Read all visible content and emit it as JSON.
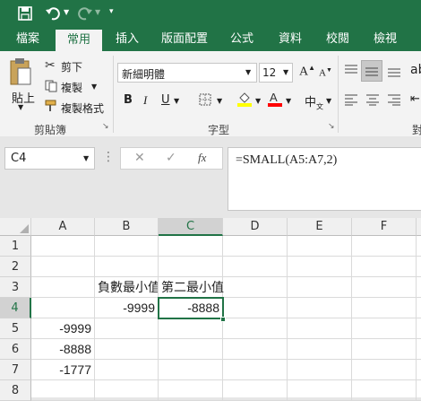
{
  "qat": {
    "save_icon": "save-icon",
    "undo_icon": "undo-icon",
    "redo_icon": "redo-icon",
    "customize_icon": "customize-qat-icon"
  },
  "tabs": [
    "檔案",
    "常用",
    "插入",
    "版面配置",
    "公式",
    "資料",
    "校閱",
    "檢視"
  ],
  "active_tab": "常用",
  "clipboard": {
    "paste": "貼上",
    "cut": "剪下",
    "copy": "複製",
    "format_painter": "複製格式",
    "group": "剪貼簿"
  },
  "font": {
    "name": "新細明體",
    "size": "12",
    "bold": "B",
    "italic": "I",
    "underline": "U",
    "group": "字型"
  },
  "formula_bar": {
    "name_box": "C4",
    "cancel": "✕",
    "enter": "✓",
    "fx": "fx",
    "formula": "=SMALL(A5:A7,2)"
  },
  "columns": [
    "A",
    "B",
    "C",
    "D",
    "E",
    "F"
  ],
  "rows": [
    "1",
    "2",
    "3",
    "4",
    "5",
    "6",
    "7",
    "8"
  ],
  "cells": {
    "B3": "負數最小值",
    "C3": "第二最小值",
    "B4": "-9999",
    "C4": "-8888",
    "A5": "-9999",
    "A6": "-8888",
    "A7": "-1777"
  },
  "colors": {
    "excel_green": "#217346",
    "selection_border": "#217346"
  }
}
